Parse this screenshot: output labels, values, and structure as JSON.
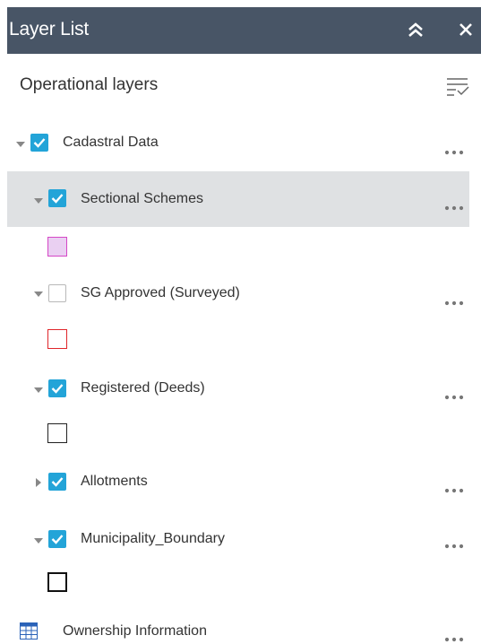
{
  "panel": {
    "title": "Layer List",
    "collapse_icon": "double-chevron-up-icon",
    "close_icon": "close-icon"
  },
  "section": {
    "title": "Operational layers",
    "options_icon": "layer-options-icon"
  },
  "layers": [
    {
      "label": "Cadastral Data",
      "checked": true,
      "expanded": true
    },
    {
      "label": "Sectional Schemes",
      "checked": true,
      "expanded": true,
      "selected": true,
      "legend_stroke": "#d548c6",
      "legend_fill": "#ead0f2"
    },
    {
      "label": "SG Approved (Surveyed)",
      "checked": false,
      "expanded": true,
      "legend_stroke": "#e0262a",
      "legend_fill": "#ffffff"
    },
    {
      "label": "Registered (Deeds)",
      "checked": true,
      "expanded": true,
      "legend_stroke": "#222222",
      "legend_fill": "#ffffff"
    },
    {
      "label": "Allotments",
      "checked": true,
      "expanded": false
    },
    {
      "label": "Municipality_Boundary",
      "checked": true,
      "expanded": true,
      "legend_stroke": "#111111",
      "legend_fill": "#ffffff"
    },
    {
      "label": "Ownership Information",
      "type": "table"
    }
  ],
  "colors": {
    "header_bg": "#485566",
    "checkbox_checked": "#23a4d8",
    "selected_row": "#dfe1e3",
    "table_icon": "#2a62b8"
  }
}
